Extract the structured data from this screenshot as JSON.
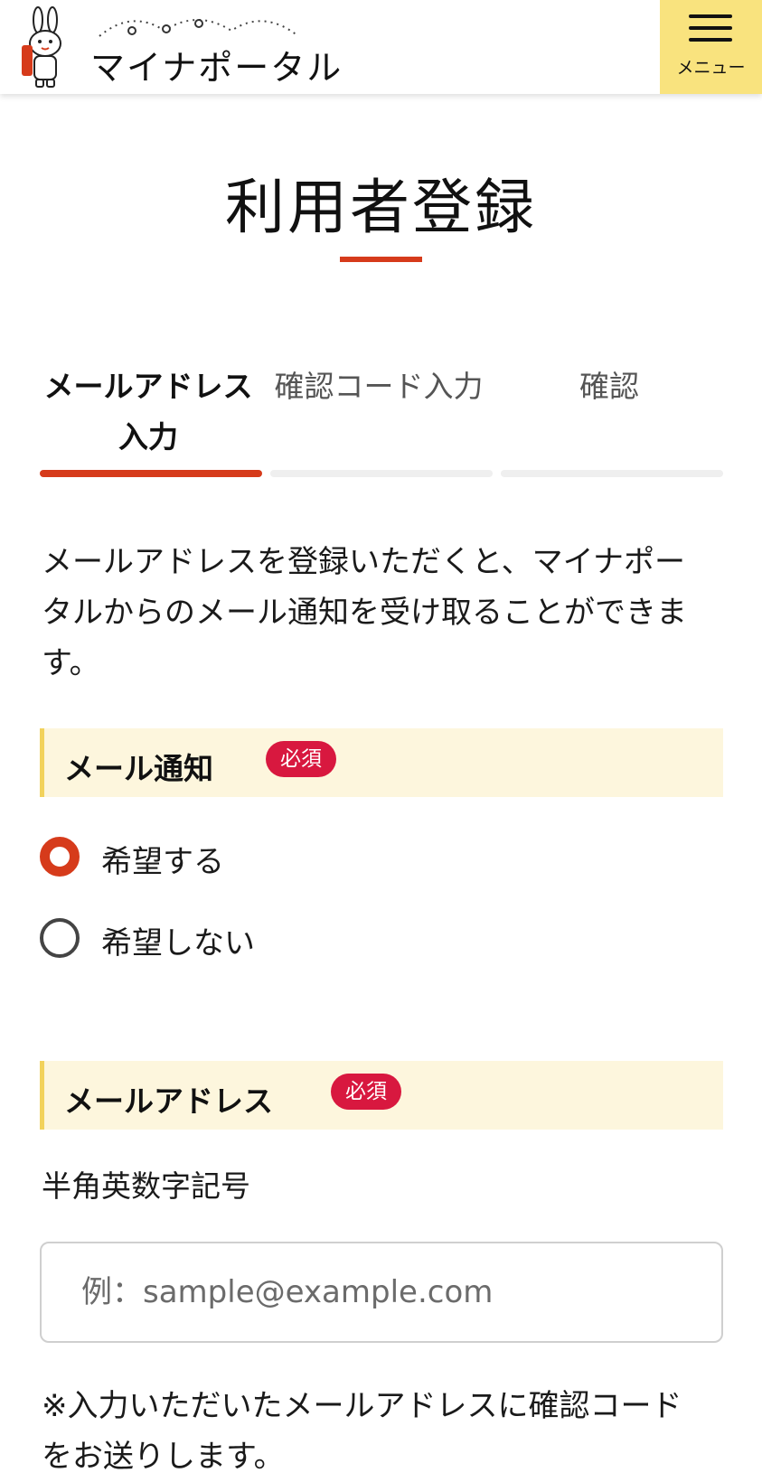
{
  "header": {
    "logo_text": "マイナポータル",
    "menu_label": "メニュー"
  },
  "page": {
    "title": "利用者登録"
  },
  "steps": [
    {
      "label": "メールアドレス入力",
      "state": "current"
    },
    {
      "label": "確認コード入力",
      "state": "upcoming"
    },
    {
      "label": "確認",
      "state": "upcoming"
    }
  ],
  "intro": "メールアドレスを登録いただくと、マイナポータルからのメール通知を受け取ることができます。",
  "notification_section": {
    "title": "メール通知",
    "badge": "必須",
    "options": [
      {
        "label": "希望する",
        "selected": true
      },
      {
        "label": "希望しない",
        "selected": false
      }
    ]
  },
  "email_section": {
    "title": "メールアドレス",
    "badge": "必須",
    "note": "半角英数字記号",
    "placeholder": "例：sample@example.com",
    "value": "",
    "footnote": "※入力いただいたメールアドレスに確認コードをお送りします。"
  },
  "colors": {
    "accent": "#d63b1b",
    "menu_bg": "#f9e37e",
    "section_bg": "#fdf6dd",
    "required_badge": "#d8183f"
  }
}
